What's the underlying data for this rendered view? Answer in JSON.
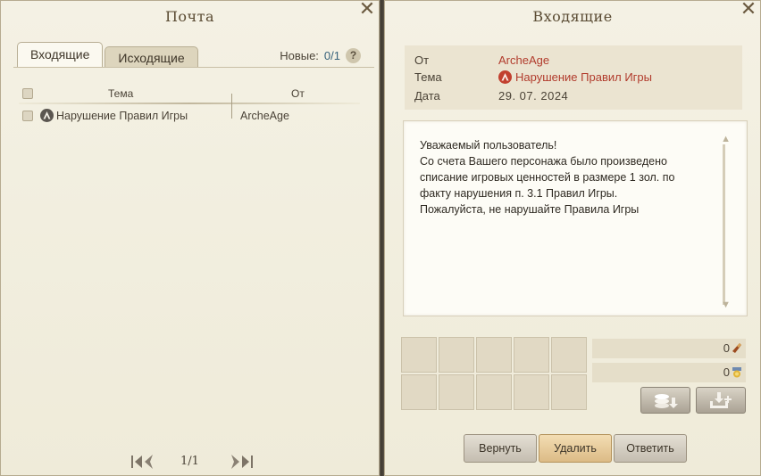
{
  "left": {
    "title": "Почта",
    "tabs": [
      {
        "label": "Входящие",
        "active": true
      },
      {
        "label": "Исходящие",
        "active": false
      }
    ],
    "new_label": "Новые:",
    "new_value": "0/1",
    "help": "?",
    "columns": {
      "subject": "Тема",
      "from": "От"
    },
    "rows": [
      {
        "subject": "Нарушение Правил Игры",
        "from": "ArcheAge"
      }
    ],
    "pager": {
      "text": "1/1"
    }
  },
  "right": {
    "title": "Входящие",
    "meta": {
      "from_label": "От",
      "from_value": "ArcheAge",
      "subject_label": "Тема",
      "subject_value": "Нарушение Правил Игры",
      "date_label": "Дата",
      "date_value": "29. 07. 2024"
    },
    "body_lines": [
      "Уважаемый пользователь!",
      "Со счета Вашего персонажа было произведено",
      "списание игровых ценностей в размере 1 зол. по",
      "факту нарушения п. 3.1 Правил Игры.",
      "Пожалуйста, не нарушайте Правила Игры"
    ],
    "currency": [
      {
        "value": "0",
        "icon": "coin-icon"
      },
      {
        "value": "0",
        "icon": "medal-icon"
      }
    ],
    "buttons": {
      "return": "Вернуть",
      "delete": "Удалить",
      "reply": "Ответить"
    }
  },
  "colors": {
    "accent_red": "#b13b2c",
    "new_count_blue": "#35607a"
  }
}
